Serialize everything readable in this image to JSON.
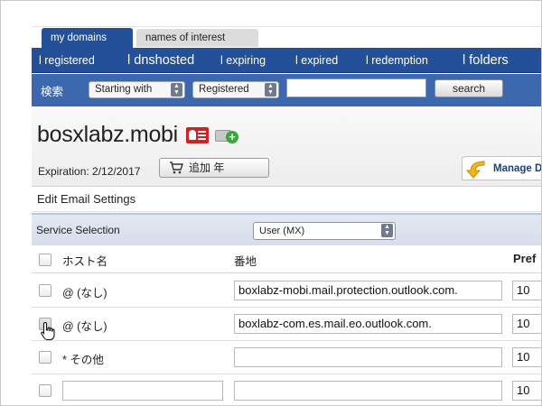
{
  "tabs": {
    "active": "my domains",
    "inactive": "names of interest"
  },
  "nav": {
    "items": [
      {
        "label": "l registered",
        "size": "small"
      },
      {
        "label": "l dnshosted",
        "size": "large"
      },
      {
        "label": "l expiring",
        "size": "small"
      },
      {
        "label": "l expired",
        "size": "small"
      },
      {
        "label": "l redemption",
        "size": "small"
      },
      {
        "label": "l folders",
        "size": "large"
      }
    ]
  },
  "search": {
    "label": "検索",
    "mode_select": "Starting with",
    "type_select": "Registered",
    "input_value": "",
    "button_label": "search"
  },
  "domain": {
    "name": "bosxlabz.mobi",
    "expiration": "Expiration: 2/12/2017",
    "add_year_label": "追加 年",
    "manage_label": "Manage D"
  },
  "section": {
    "title": "Edit Email Settings"
  },
  "service": {
    "label": "Service Selection",
    "selected": "User (MX)"
  },
  "table": {
    "headers": {
      "host": "ホスト名",
      "address": "番地",
      "pref": "Pref"
    },
    "rows": [
      {
        "host": "@ (なし)",
        "host_is_input": false,
        "address": "boxlabz-mobi.mail.protection.outlook.com.",
        "pref": "10",
        "checked": false
      },
      {
        "host": "@ (なし)",
        "host_is_input": false,
        "address": "boxlabz-com.es.mail.eo.outlook.com.",
        "pref": "10",
        "checked": true
      },
      {
        "host": "* その他",
        "host_is_input": false,
        "address": "",
        "pref": "10",
        "checked": false
      },
      {
        "host": "",
        "host_is_input": true,
        "address": "",
        "pref": "10",
        "checked": false
      }
    ]
  },
  "colors": {
    "nav_blue": "#24509a",
    "search_blue": "#3e68ad",
    "accent_red": "#cc2323",
    "accent_green": "#36a83b"
  }
}
